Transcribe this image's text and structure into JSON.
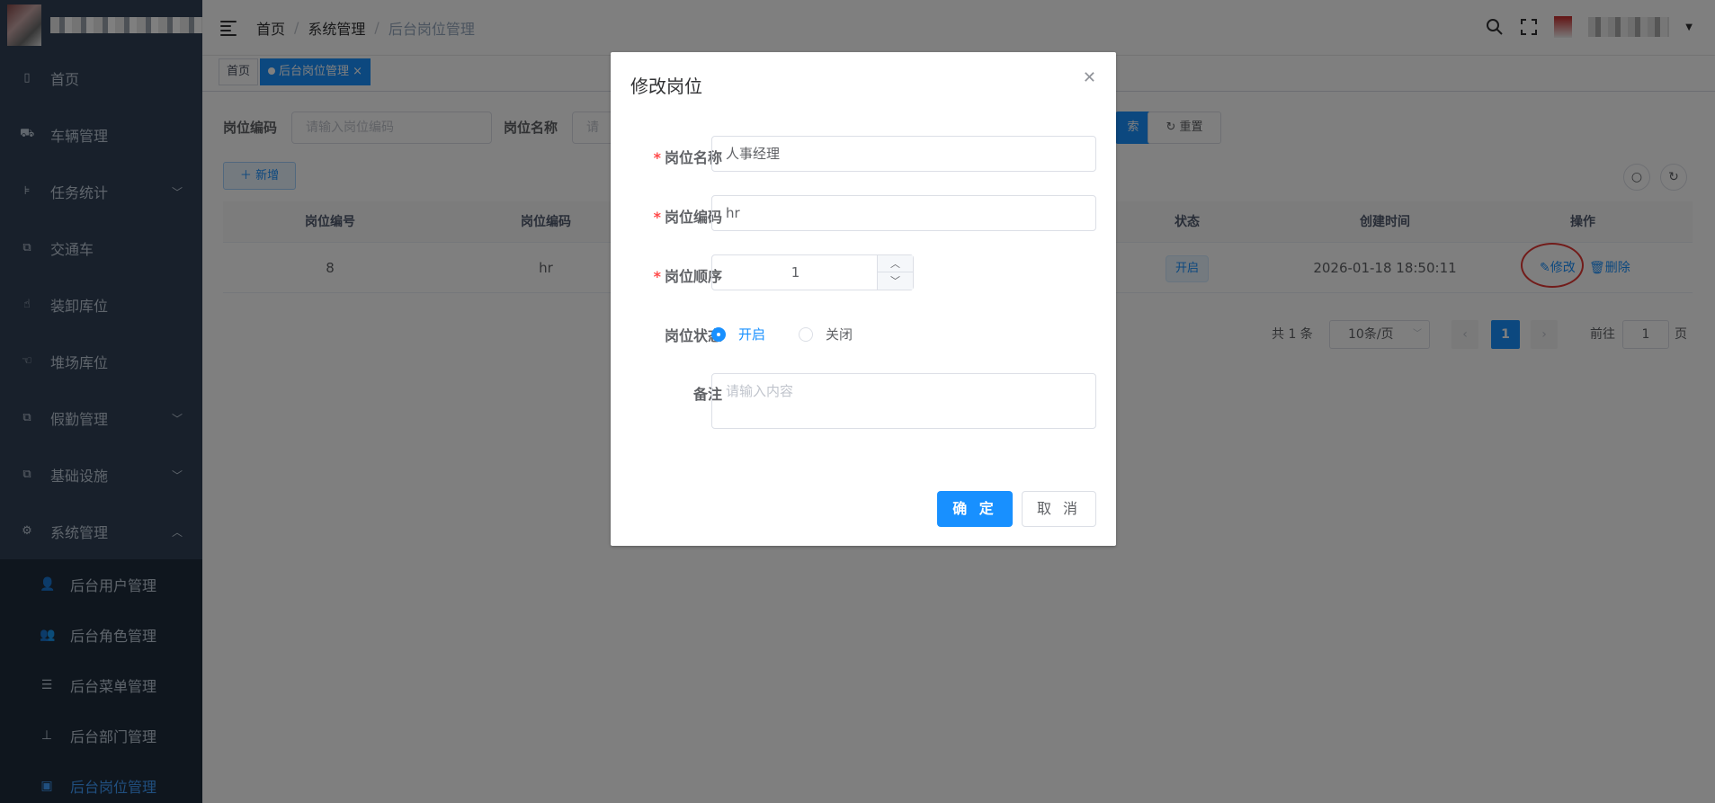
{
  "sidebar": {
    "items": [
      {
        "label": "首页",
        "icon": "dashboard-icon"
      },
      {
        "label": "车辆管理",
        "icon": "car-icon"
      },
      {
        "label": "任务统计",
        "icon": "tree-icon",
        "arrow": "﹀"
      },
      {
        "label": "交通车",
        "icon": "copy-icon"
      },
      {
        "label": "装卸库位",
        "icon": "hand-icon"
      },
      {
        "label": "堆场库位",
        "icon": "thumb-icon"
      },
      {
        "label": "假勤管理",
        "icon": "copy-icon",
        "arrow": "﹀"
      },
      {
        "label": "基础设施",
        "icon": "copy-icon",
        "arrow": "﹀"
      },
      {
        "label": "系统管理",
        "icon": "gear-icon",
        "arrow": "︿"
      }
    ],
    "sub_items": [
      {
        "label": "后台用户管理",
        "icon": "user-icon"
      },
      {
        "label": "后台角色管理",
        "icon": "peoples-icon"
      },
      {
        "label": "后台菜单管理",
        "icon": "list-icon"
      },
      {
        "label": "后台部门管理",
        "icon": "tree-table-icon"
      },
      {
        "label": "后台岗位管理",
        "icon": "post-icon"
      }
    ]
  },
  "breadcrumb": [
    "首页",
    "系统管理",
    "后台岗位管理"
  ],
  "tags": [
    "首页",
    "后台岗位管理"
  ],
  "search": {
    "code_label": "岗位编码",
    "code_placeholder": "请输入岗位编码",
    "name_label": "岗位名称",
    "name_placeholder": "请",
    "search_btn_tail": "索",
    "reset_label": "重置"
  },
  "toolbar": {
    "add_label": "新增"
  },
  "table": {
    "headers": [
      "岗位编号",
      "岗位编码",
      "状态",
      "创建时间",
      "操作"
    ],
    "rows": [
      {
        "id": "8",
        "code": "hr",
        "status": "开启",
        "created": "2026-01-18 18:50:11",
        "edit": "修改",
        "delete": "删除"
      }
    ]
  },
  "pagination": {
    "total": "共 1 条",
    "page_size": "10条/页",
    "current_page": "1",
    "goto_label": "前往",
    "goto_value": "1",
    "page_suffix": "页"
  },
  "dialog": {
    "title": "修改岗位",
    "fields": {
      "name_label": "岗位名称",
      "name_value": "人事经理",
      "code_label": "岗位编码",
      "code_value": "hr",
      "sort_label": "岗位顺序",
      "sort_value": "1",
      "status_label": "岗位状态",
      "status_on": "开启",
      "status_off": "关闭",
      "remark_label": "备注",
      "remark_placeholder": "请输入内容"
    },
    "confirm_label": "确 定",
    "cancel_label": "取 消"
  },
  "colors": {
    "primary": "#1890ff",
    "sidebar": "#304156",
    "required": "#ff4949",
    "annotation": "#e53935"
  }
}
